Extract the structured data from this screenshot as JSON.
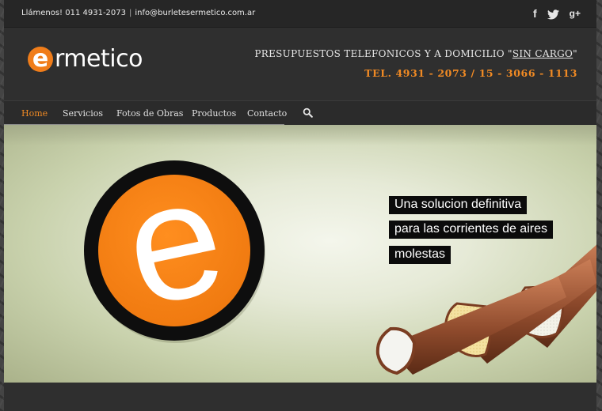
{
  "topbar": {
    "phone_text": "Llámenos! 011 4931-2073",
    "separator": "|",
    "email": "info@burletesermetico.com.ar",
    "social": [
      {
        "name": "facebook",
        "glyph": "f"
      },
      {
        "name": "twitter",
        "glyph": "🐦"
      },
      {
        "name": "google-plus",
        "glyph": "g+"
      }
    ]
  },
  "header": {
    "logo_letter": "e",
    "logo_text": "rmetico",
    "tagline_prefix": "PRESUPUESTOS TELEFONICOS Y A DOMICILIO \"",
    "tagline_highlight": "SIN CARGO",
    "tagline_suffix": "\"",
    "phones": "TEL. 4931 - 2073  /  15 - 3066 - 1113"
  },
  "nav": {
    "items": [
      {
        "label": "Home",
        "active": true
      },
      {
        "label": "Servicios",
        "active": false
      },
      {
        "label": "Fotos de Obras",
        "active": false
      },
      {
        "label": "Productos",
        "active": false
      },
      {
        "label": "Contacto",
        "active": false
      }
    ],
    "search_icon": "search-icon"
  },
  "hero": {
    "lines": [
      "Una solucion definitiva",
      "para las corrientes de aires",
      "molestas"
    ],
    "logo_letter": "e"
  },
  "colors": {
    "accent": "#f08a24",
    "logo_orange": "#f07d1a",
    "header_bg": "#2f2f2f",
    "topbar_bg": "#262626"
  }
}
